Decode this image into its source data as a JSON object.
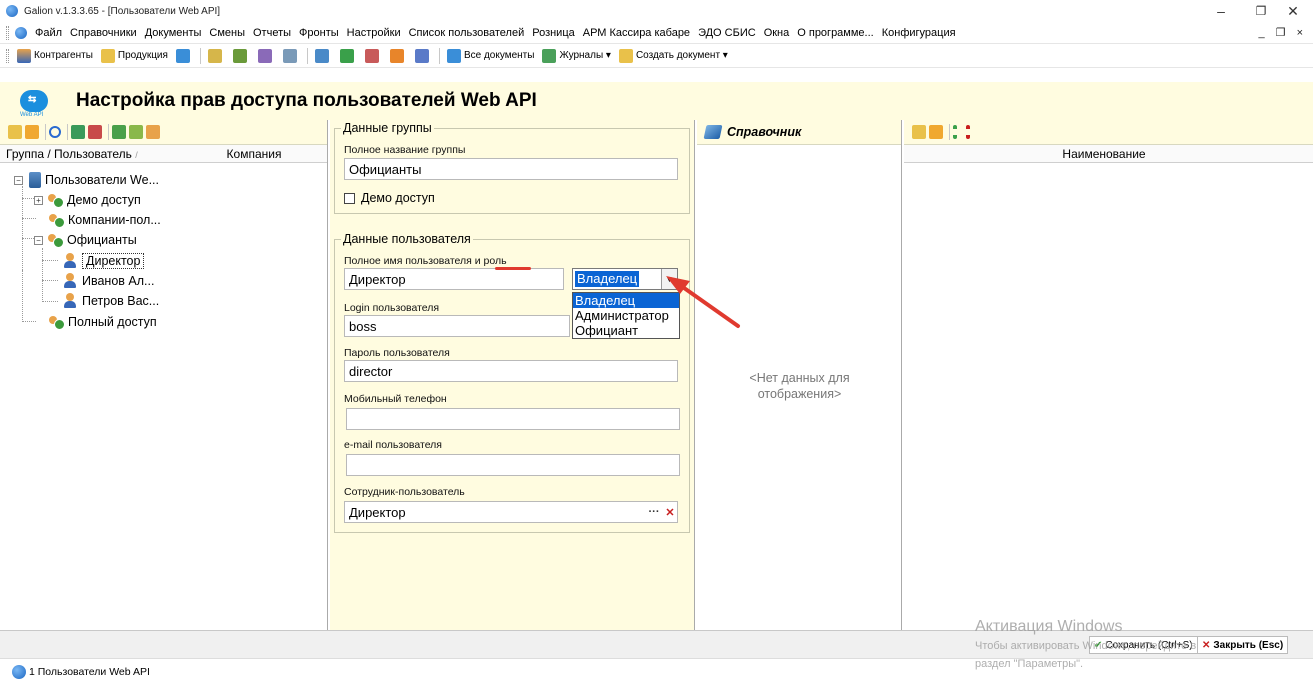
{
  "window": {
    "title": "Galion  v.1.3.3.65  - [Пользователи Web API]",
    "controls": [
      "–",
      "❐",
      "✕"
    ]
  },
  "menu": {
    "items": [
      "Файл",
      "Справочники",
      "Документы",
      "Смены",
      "Отчеты",
      "Фронты",
      "Настройки",
      "Список пользователей",
      "Розница",
      "АРМ Кассира кабаре",
      "ЭДО СБИС",
      "Окна",
      "О программе...",
      "Конфигурация"
    ],
    "mdi_controls": "_ ❐ ×"
  },
  "toolbar": {
    "contractors": "Контрагенты",
    "products": "Продукция",
    "all_docs": "Все документы",
    "journals": "Журналы ▾",
    "create_doc": "Создать документ ▾"
  },
  "header": {
    "logo_caption": "Web API",
    "title": "Настройка прав доступа пользователей Web API"
  },
  "tree": {
    "columns": [
      "Группа / Пользователь",
      "Компания"
    ],
    "root": "Пользователи We...",
    "nodes": {
      "demo": "Демо доступ",
      "companies": "Компании-пол...",
      "waiters": "Официанты",
      "director": "Директор",
      "ivanov": "Иванов Ал...",
      "petrov": "Петров Вас...",
      "full": "Полный доступ"
    }
  },
  "group_data": {
    "title": "Данные группы",
    "full_name_label": "Полное название группы",
    "full_name_value": "Официанты",
    "demo_access_label": "Демо доступ"
  },
  "user_data": {
    "title": "Данные пользователя",
    "full_name_label": "Полное имя пользователя и роль",
    "full_name_value": "Директор",
    "role_value": "Владелец",
    "role_options": [
      "Владелец",
      "Администратор",
      "Официант"
    ],
    "login_label": "Login пользователя",
    "login_value": "boss",
    "password_label": "Пароль пользователя",
    "password_value": "director",
    "phone_label": "Мобильный телефон",
    "phone_value": "",
    "email_label": "e-mail пользователя",
    "email_value": "",
    "employee_label": "Сотрудник-пользователь",
    "employee_value": "Директор"
  },
  "reference": {
    "title": "Справочник",
    "empty_line1": "<Нет данных для",
    "empty_line2": "отображения>"
  },
  "list": {
    "column": "Наименование"
  },
  "status": {
    "save": "Сохранить (Ctrl+S)",
    "close": "Закрыть (Esc)",
    "task_tab": "1 Пользователи Web API"
  },
  "watermark": {
    "line1": "Активация Windows",
    "line2": "Чтобы активировать Windows, перейдите в",
    "line3": "раздел \"Параметры\"."
  },
  "colors": {
    "panel_bg": "#fffce0",
    "selection": "#0a64d4",
    "annotation": "#e03a2f",
    "brand": "#1b8fde"
  }
}
